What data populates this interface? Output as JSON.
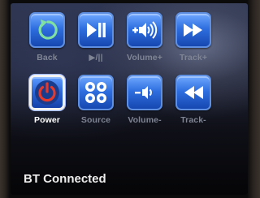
{
  "buttons": {
    "back": {
      "label": "Back",
      "icon": "back-arrow-icon"
    },
    "play_pause": {
      "label": "▶/||",
      "icon": "play-pause-icon"
    },
    "volume_up": {
      "label": "Volume+",
      "icon": "volume-up-icon"
    },
    "track_next": {
      "label": "Track+",
      "icon": "fast-forward-icon"
    },
    "power": {
      "label": "Power",
      "icon": "power-icon",
      "selected": true
    },
    "source": {
      "label": "Source",
      "icon": "source-icon"
    },
    "volume_down": {
      "label": "Volume-",
      "icon": "volume-down-icon"
    },
    "track_prev": {
      "label": "Track-",
      "icon": "rewind-icon"
    }
  },
  "status": {
    "text": "BT Connected"
  },
  "colors": {
    "tile": "#2f6fe0",
    "power_icon": "#e33a2c",
    "icon_white": "#ffffff",
    "label_dim": "#7f8594"
  }
}
